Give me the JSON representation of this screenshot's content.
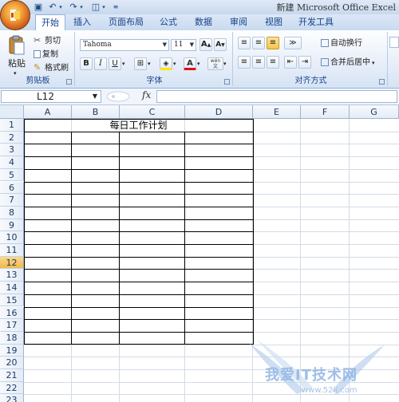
{
  "window": {
    "title": "新建 Microsoft Office Excel"
  },
  "tabs": [
    {
      "label": "开始",
      "active": true
    },
    {
      "label": "插入"
    },
    {
      "label": "页面布局"
    },
    {
      "label": "公式"
    },
    {
      "label": "数据"
    },
    {
      "label": "审阅"
    },
    {
      "label": "视图"
    },
    {
      "label": "开发工具"
    }
  ],
  "clipboard": {
    "paste": "粘贴",
    "cut": "剪切",
    "copy": "复制",
    "format_painter": "格式刷",
    "label": "剪贴板"
  },
  "font": {
    "name": "Tahoma",
    "size": "11",
    "bold": "B",
    "italic": "I",
    "underline": "U",
    "label": "字体",
    "wen": "wén"
  },
  "alignment": {
    "wrap_text": "自动换行",
    "merge_center": "合并后居中",
    "label": "对齐方式"
  },
  "formula_bar": {
    "name_box": "L12",
    "fx": "fx",
    "formula": ""
  },
  "sheet": {
    "columns": [
      "A",
      "B",
      "C",
      "D",
      "E",
      "F",
      "G"
    ],
    "rows": [
      "1",
      "2",
      "3",
      "4",
      "5",
      "6",
      "7",
      "8",
      "9",
      "10",
      "11",
      "12",
      "13",
      "14",
      "15",
      "16",
      "17",
      "18",
      "19",
      "20",
      "21",
      "22",
      "23"
    ],
    "selected_row": "12",
    "title_cell": "每日工作计划"
  },
  "watermark": {
    "text": "我爱IT技术网",
    "url": "www.52ij.com"
  },
  "colors": {
    "accent": "#15428b",
    "selected_row": "#f2b84c"
  }
}
